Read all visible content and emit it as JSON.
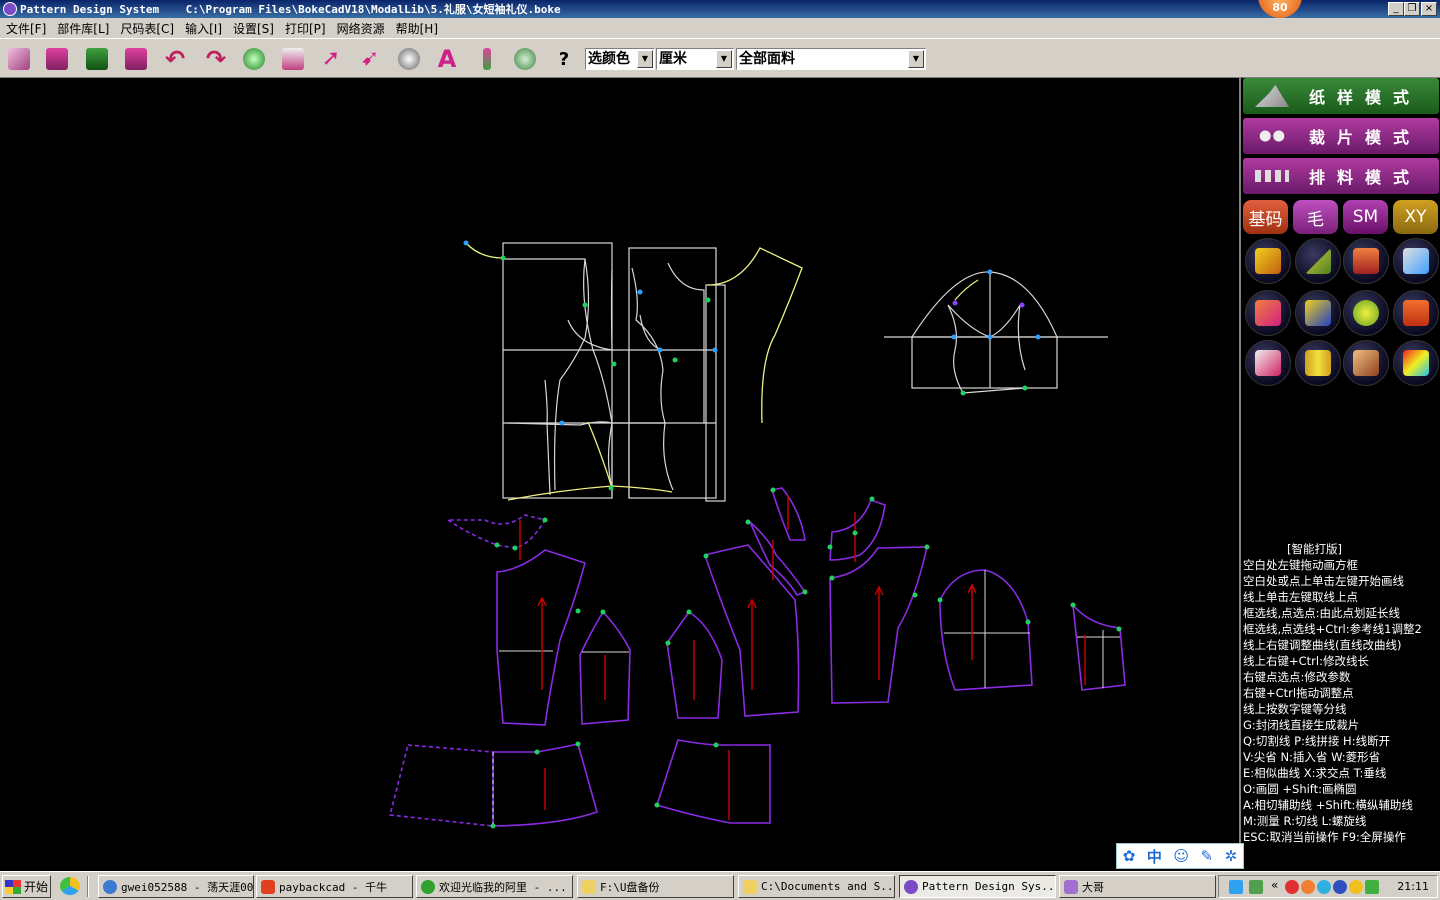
{
  "window": {
    "app_name": "Pattern Design System",
    "file_path": "C:\\Program Files\\BokeCadV18\\ModalLib\\5.礼服\\女短袖礼仪.boke",
    "badge": "80"
  },
  "menu": [
    "文件[F]",
    "部件库[L]",
    "尺码表[C]",
    "输入[I]",
    "设置[S]",
    "打印[P]",
    "网络资源",
    "帮助[H]"
  ],
  "toolbar": {
    "help_label": "?",
    "color_select": "选颜色",
    "unit_select": "厘米",
    "fabric_select": "全部面料"
  },
  "modes": [
    "纸样模式",
    "裁片模式",
    "排料模式"
  ],
  "chips": [
    "基码",
    "毛",
    "SM",
    "XY"
  ],
  "help_text": [
    "[智能打版]",
    "空白处左键拖动画方框",
    "空白处或点上单击左键开始画线",
    "线上单击左键取线上点",
    "框选线,点选点:由此点划延长线",
    "框选线,点选线+Ctrl:参考线1调整2",
    "线上右键调整曲线(直线改曲线)",
    "线上右键+Ctrl:修改线长",
    "右键点选点:修改参数",
    "右键+Ctrl拖动调整点",
    "线上按数字键等分线",
    "G:封闭线直接生成裁片",
    "Q:切割线  P:线拼接  H:线断开",
    "V:尖省  N:插入省  W:菱形省",
    "E:相似曲线  X:求交点  T:垂线",
    "O:画圆 +Shift:画椭圆",
    "A:相切辅助线 +Shift:横纵辅助线",
    "M:测量  R:切线  L:螺旋线",
    "ESC:取消当前操作  F9:全屏操作"
  ],
  "ime": [
    "中"
  ],
  "taskbar": {
    "start": "开始",
    "tasks": [
      "gwei052588 - 荡天涯00",
      "paybackcad - 千牛",
      "欢迎光临我的阿里 - ...",
      "F:\\U盘备份",
      "C:\\Documents and S...",
      "Pattern Design Sys...",
      "大哥"
    ],
    "clock": "21:11"
  },
  "colors": {
    "pattern_white": "#e8e8e8",
    "pattern_yellow": "#f0f080",
    "piece_outline": "#8a2be2",
    "grain_red": "#d00000",
    "point_green": "#20d060",
    "point_cyan": "#30a0ff"
  }
}
